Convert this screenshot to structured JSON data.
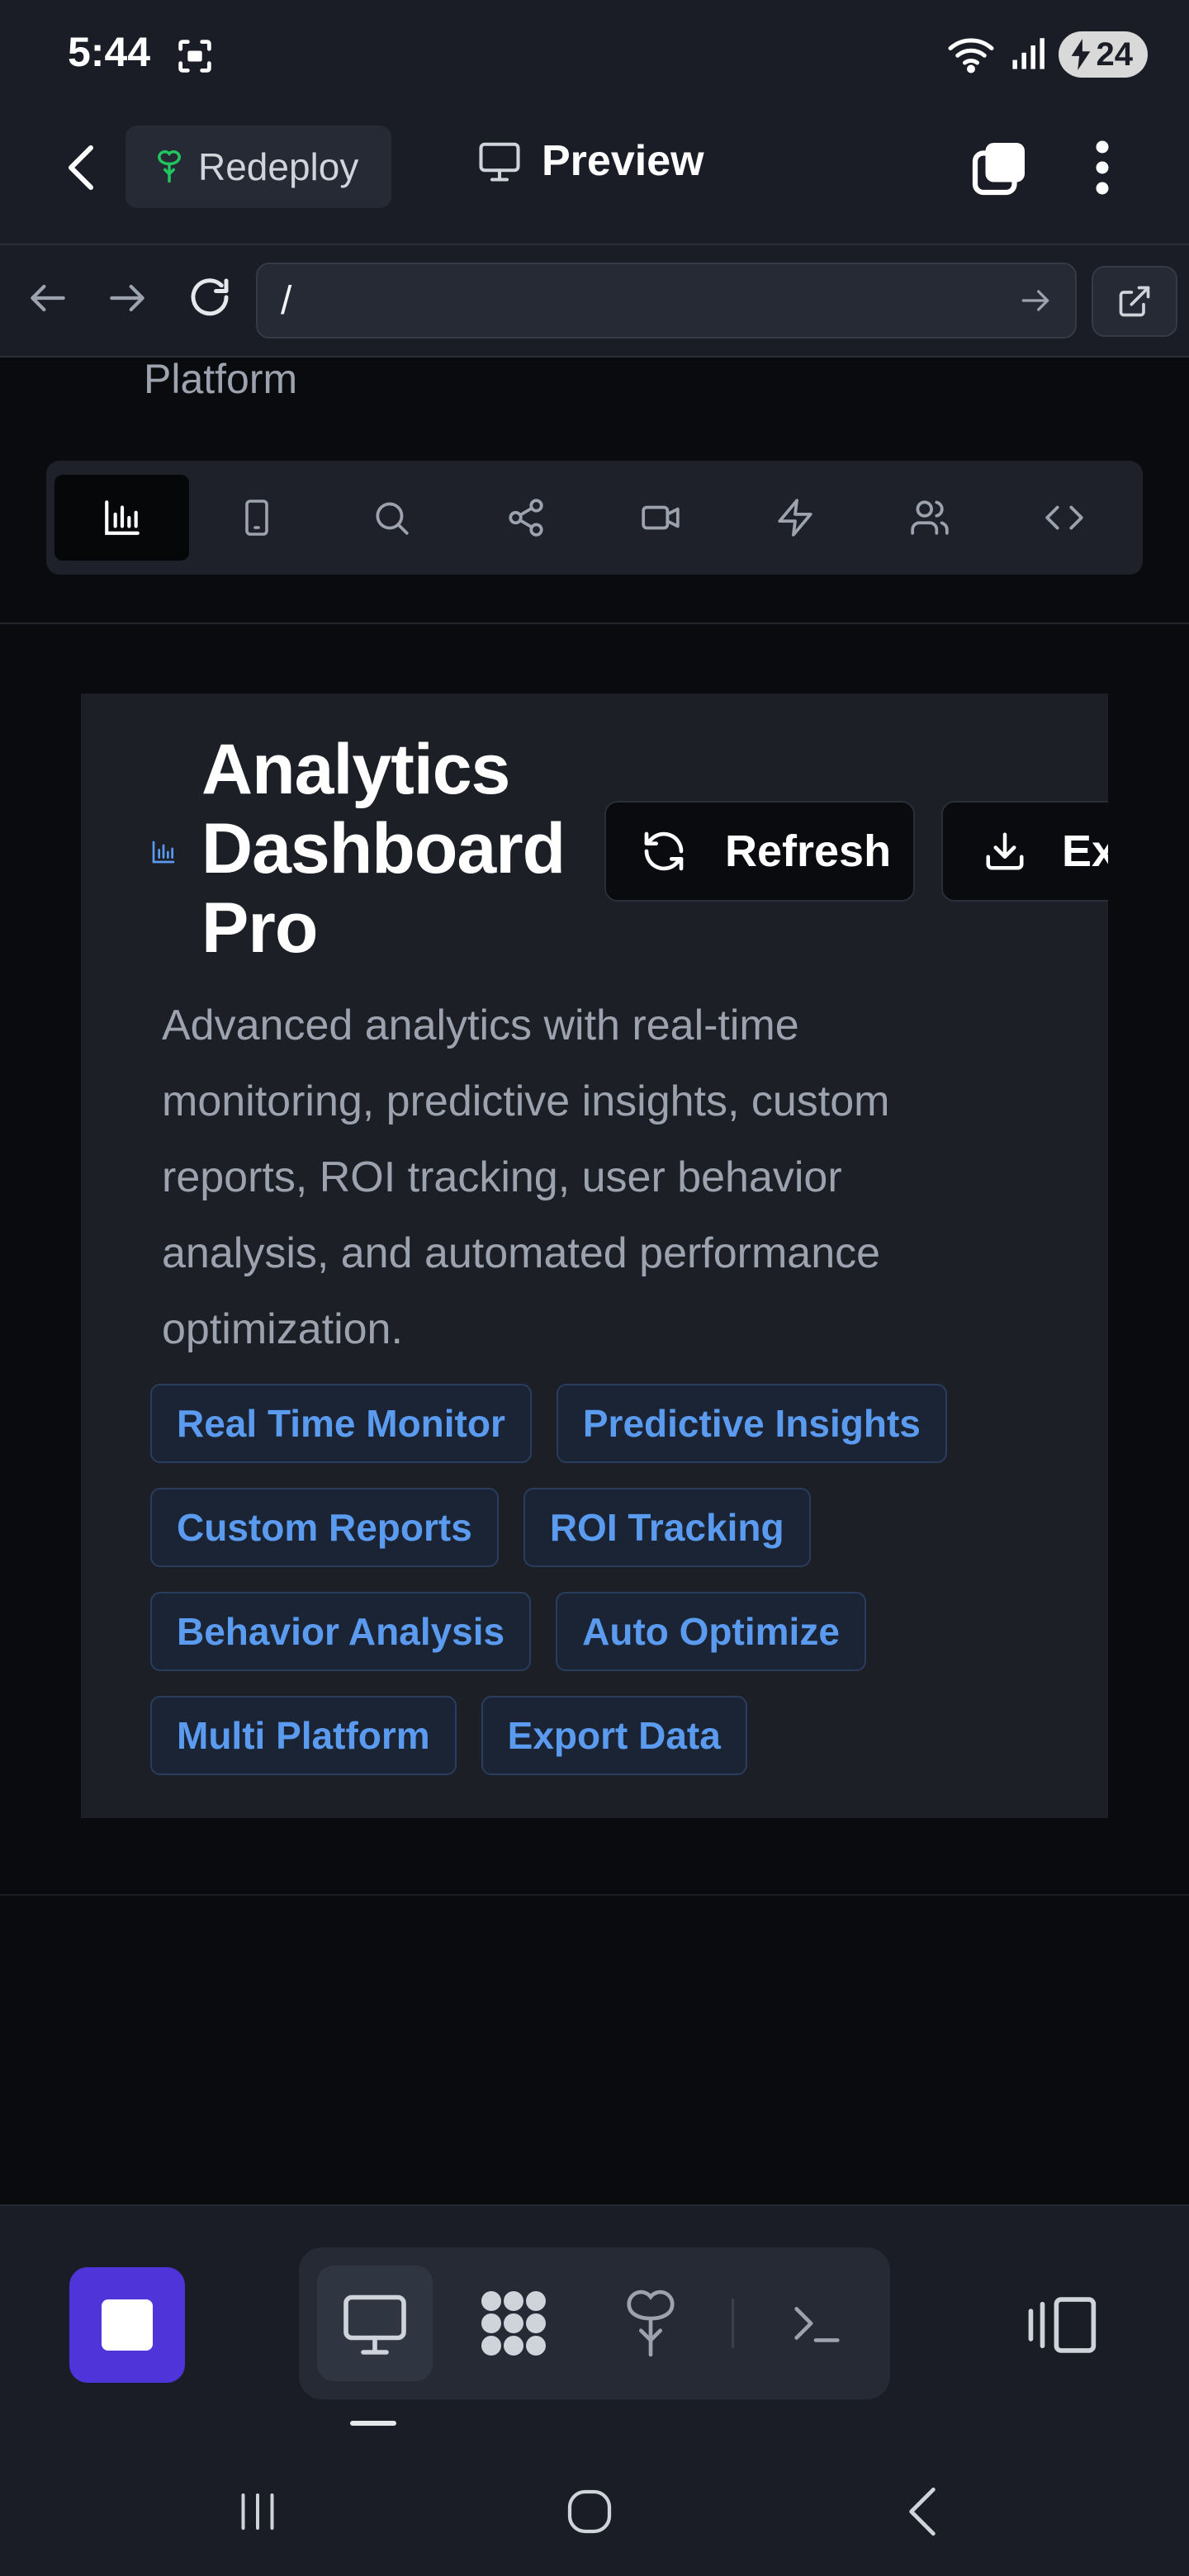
{
  "status_bar": {
    "time": "5:44",
    "battery": "24"
  },
  "app_bar": {
    "redeploy_label": "Redeploy",
    "preview_label": "Preview"
  },
  "browser": {
    "url": "/"
  },
  "page": {
    "partial_text": "Platform",
    "icon_tabs": [
      {
        "icon": "bar-chart-icon",
        "active": true
      },
      {
        "icon": "smartphone-icon",
        "active": false
      },
      {
        "icon": "search-icon",
        "active": false
      },
      {
        "icon": "share-icon",
        "active": false
      },
      {
        "icon": "video-icon",
        "active": false
      },
      {
        "icon": "lightning-icon",
        "active": false
      },
      {
        "icon": "users-icon",
        "active": false
      },
      {
        "icon": "code-icon",
        "active": false
      }
    ],
    "card": {
      "title": "Analytics Dashboard Pro",
      "refresh_label": "Refresh",
      "export_label": "Export",
      "description": "Advanced analytics with real-time monitoring, predictive insights, custom reports, ROI tracking, user behavior analysis, and automated performance optimization.",
      "tags": [
        "Real Time Monitor",
        "Predictive Insights",
        "Custom Reports",
        "ROI Tracking",
        "Behavior Analysis",
        "Auto Optimize",
        "Multi Platform",
        "Export Data"
      ]
    }
  },
  "bottom_toolbar": {
    "tools": [
      "monitor-icon",
      "apps-grid-icon",
      "deploy-icon",
      "terminal-icon"
    ]
  },
  "colors": {
    "accent_purple": "#4f35d9",
    "tag_text": "#5a9bf0",
    "tag_bg": "#1b2434",
    "redeploy_icon": "#22c55e"
  }
}
